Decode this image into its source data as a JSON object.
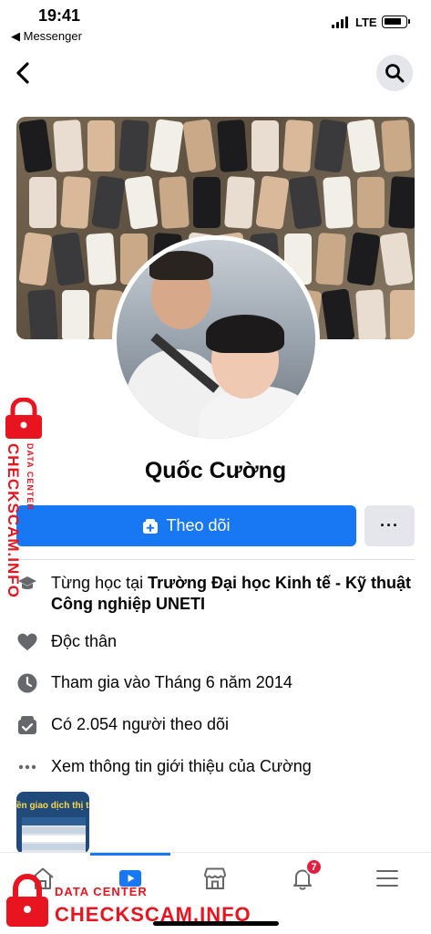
{
  "status_bar": {
    "time": "19:41",
    "back_app": "◀ Messenger",
    "network": "LTE"
  },
  "nav": {
    "back_icon": "chevron-left-icon",
    "search_icon": "search-icon"
  },
  "profile": {
    "name": "Quốc Cường"
  },
  "actions": {
    "follow_label": "Theo dõi",
    "more_label": "···"
  },
  "info": {
    "education_prefix": "Từng học tại ",
    "education_school": "Trường Đại học Kinh tế - Kỹ thuật Công nghiệp UNETI",
    "relationship": "Độc thân",
    "joined": "Tham gia vào Tháng 6 năm 2014",
    "followers": "Có 2.054 người theo dõi",
    "see_about": "Xem thông tin giới thiệu của Cường"
  },
  "thumb": {
    "title": "ền giao dịch thị trườn"
  },
  "tabbar": {
    "notification_count": "7",
    "active_tab": "watch"
  },
  "watermark": {
    "brand": "CHECKSCAM.INFO",
    "sub": "DATA CENTER"
  },
  "colors": {
    "accent": "#1877f2",
    "badge": "#e41e3f",
    "watermark": "#e8141f"
  }
}
